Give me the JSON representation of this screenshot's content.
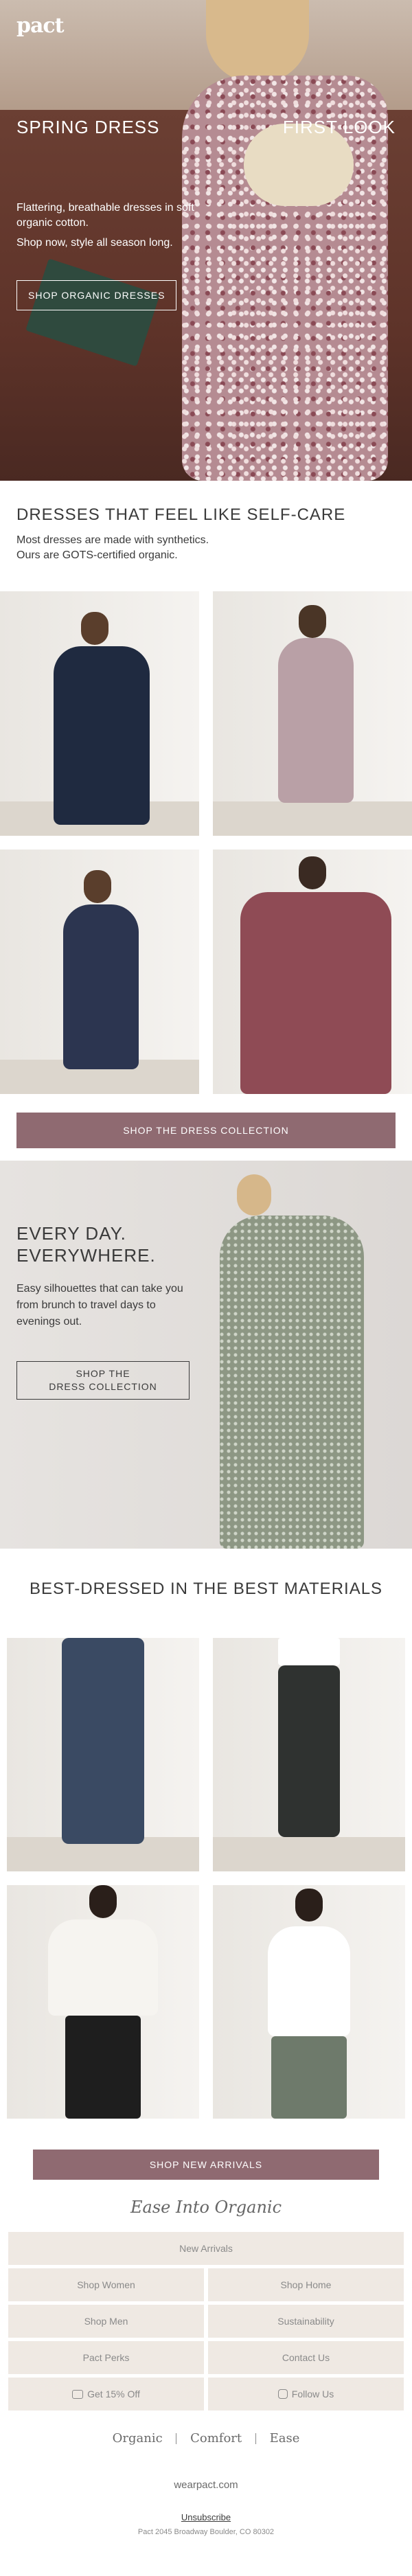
{
  "hero": {
    "logo": "pact",
    "headline_left": "SPRING DRESS",
    "headline_right": "FIRST LOOK",
    "subtext": "Flattering, breathable dresses in soft organic cotton.",
    "subtext2": "Shop now, style all season long.",
    "cta": "SHOP ORGANIC DRESSES"
  },
  "dresses": {
    "title": "DRESSES THAT FEEL LIKE SELF-CARE",
    "line1": "Most dresses are made with synthetics.",
    "line2": "Ours are GOTS-certified organic.",
    "cta": "SHOP THE DRESS COLLECTION"
  },
  "everyday": {
    "title_line1": "EVERY DAY.",
    "title_line2": "EVERYWHERE.",
    "body": "Easy silhouettes that can take you from brunch to travel days to evenings out.",
    "cta_line1": "SHOP THE",
    "cta_line2": "DRESS COLLECTION"
  },
  "materials": {
    "title": "BEST-DRESSED IN THE BEST MATERIALS",
    "cta": "SHOP NEW ARRIVALS"
  },
  "footer": {
    "heading": "Ease Into Organic",
    "new_arrivals": "New Arrivals",
    "shop_women": "Shop Women",
    "shop_home": "Shop Home",
    "shop_men": "Shop Men",
    "sustainability": "Sustainability",
    "pact_perks": "Pact Perks",
    "contact_us": "Contact Us",
    "get_off": "Get 15% Off",
    "follow_us": "Follow Us",
    "tagline_1": "Organic",
    "tagline_2": "Comfort",
    "tagline_3": "Ease",
    "site": "wearpact.com",
    "unsubscribe": "Unsubscribe",
    "address": "Pact 2045 Broadway Boulder, CO 80302"
  },
  "colors": {
    "accent": "#8f6a71",
    "footer_cell": "#efe9e3"
  }
}
